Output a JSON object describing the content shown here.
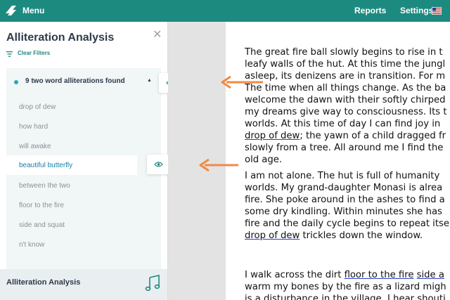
{
  "topbar": {
    "menu_label": "Menu",
    "reports_label": "Reports",
    "settings_label": "Settings",
    "accent_color": "#1d8a80"
  },
  "sidebar": {
    "title": "Alliteration Analysis",
    "clear_filters": "Clear Filters",
    "panel_header": "9 two word alliterations found",
    "items": [
      "drop of dew",
      "how hard",
      "will awake",
      "beautiful butterfly",
      "between the two",
      "floor to the fire",
      "side and squat",
      "n't know"
    ],
    "active_item_index": 3,
    "bottom_title": "Alliteration Analysis"
  },
  "document": {
    "paragraph1": [
      "The great fire ball slowly begins to rise in t",
      "leafy walls of the hut. At this time the jungl",
      "asleep, its denizens are in transition. For m",
      "The time when all things change. As the ba",
      "welcome the dawn with their softly chirped",
      "my dreams give way to consciousness. Its t",
      "worlds. At this time of day I can find joy in",
      [
        "drop of dew",
        "; the yawn of a child dragged fr"
      ],
      "slowly from a tree. All around me I find the",
      "old age."
    ],
    "paragraph2": [
      "I am not alone. The hut is full of humanity",
      "worlds. My grand-daughter Monasi is alrea",
      "fire. She poke around in the ashes to find a",
      "some dry kindling. Within minutes she has",
      "fire and the daily cycle begins to repeat itse",
      [
        "drop of dew",
        " trickles down the window."
      ]
    ],
    "paragraph3": [
      [
        "I walk across the dirt ",
        "floor to the fire",
        " ",
        "side a"
      ],
      "warm my bones by the fire as a lizard migh",
      "is a disturbance in the village. I hear shouti"
    ]
  }
}
